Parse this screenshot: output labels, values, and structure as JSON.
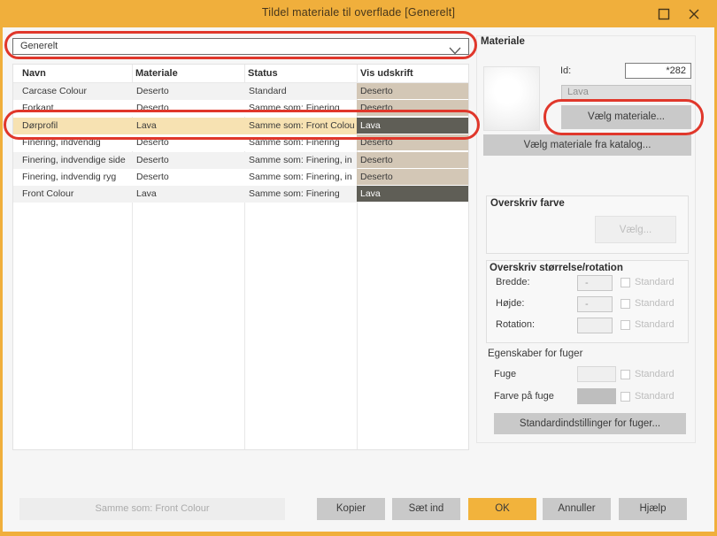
{
  "window": {
    "title": "Tildel materiale til overflade [Generelt]",
    "controls": [
      {
        "name": "maximize",
        "glyph": "square-outline"
      },
      {
        "name": "close",
        "glyph": "x"
      }
    ]
  },
  "colors": {
    "accent_orange": "#F0AF3C",
    "annotation_red": "#E0372B",
    "selected_row": "#F7E2B2",
    "alt_row": "#F2F2F2",
    "button_gray": "#C9C9C9"
  },
  "surface_combo": {
    "value": "Generelt"
  },
  "material_colors": {
    "Deserto": {
      "bg": "#D3C7B6",
      "fg": "#3A3A3A"
    },
    "Lava": {
      "bg": "#5F5E56",
      "fg": "#FFFFFF"
    }
  },
  "table": {
    "columns": [
      "Navn",
      "Materiale",
      "Status",
      "Vis udskrift"
    ],
    "rows": [
      {
        "navn": "Carcase Colour",
        "materiale": "Deserto",
        "status": "Standard",
        "vis": "Deserto",
        "selected": false
      },
      {
        "navn": "Forkant",
        "materiale": "Deserto",
        "status": "Samme som: Finering",
        "vis": "Deserto",
        "selected": false
      },
      {
        "navn": "Dørprofil",
        "materiale": "Lava",
        "status": "Samme som: Front Colou",
        "vis": "Lava",
        "selected": true
      },
      {
        "navn": "Finering, indvendig",
        "materiale": "Deserto",
        "status": "Samme som: Finering",
        "vis": "Deserto",
        "selected": false
      },
      {
        "navn": "Finering, indvendige side",
        "materiale": "Deserto",
        "status": "Samme som: Finering, in",
        "vis": "Deserto",
        "selected": false
      },
      {
        "navn": "Finering, indvendig ryg",
        "materiale": "Deserto",
        "status": "Samme som: Finering, in",
        "vis": "Deserto",
        "selected": false
      },
      {
        "navn": "Front Colour",
        "materiale": "Lava",
        "status": "Samme som: Finering",
        "vis": "Lava",
        "selected": false
      }
    ]
  },
  "materiale_panel": {
    "title": "Materiale",
    "id_label": "Id:",
    "id_value": "*282",
    "name_value": "Lava",
    "select_material_button": "Vælg materiale...",
    "select_catalog_button": "Vælg materiale fra katalog..."
  },
  "overskriv_farve": {
    "title": "Overskriv farve",
    "choose_button": "Vælg..."
  },
  "overskriv_storrelse": {
    "title": "Overskriv størrelse/rotation",
    "rows": [
      {
        "label": "Bredde:",
        "value": "-",
        "checkbox_label": "Standard",
        "checked": false
      },
      {
        "label": "Højde:",
        "value": "-",
        "checkbox_label": "Standard",
        "checked": false
      },
      {
        "label": "Rotation:",
        "value": "",
        "checkbox_label": "Standard",
        "checked": false
      }
    ]
  },
  "fuger": {
    "title": "Egenskaber for fuger",
    "rows": [
      {
        "label": "Fuge",
        "swatch": "#EFEFEF",
        "checkbox_label": "Standard",
        "checked": false
      },
      {
        "label": "Farve på fuge",
        "swatch": "#BEBEBE",
        "checkbox_label": "Standard",
        "checked": false
      }
    ],
    "settings_button": "Standardindstillinger for fuger..."
  },
  "footer": {
    "status_button": "Samme som: Front Colour",
    "buttons": [
      {
        "label": "Kopier",
        "style": "gray"
      },
      {
        "label": "Sæt ind",
        "style": "gray"
      },
      {
        "label": "OK",
        "style": "ok"
      },
      {
        "label": "Annuller",
        "style": "gray"
      },
      {
        "label": "Hjælp",
        "style": "gray"
      }
    ]
  },
  "annotations": [
    {
      "target": "surface-combo"
    },
    {
      "target": "table-row-dørprofil"
    },
    {
      "target": "select-material-button"
    }
  ]
}
